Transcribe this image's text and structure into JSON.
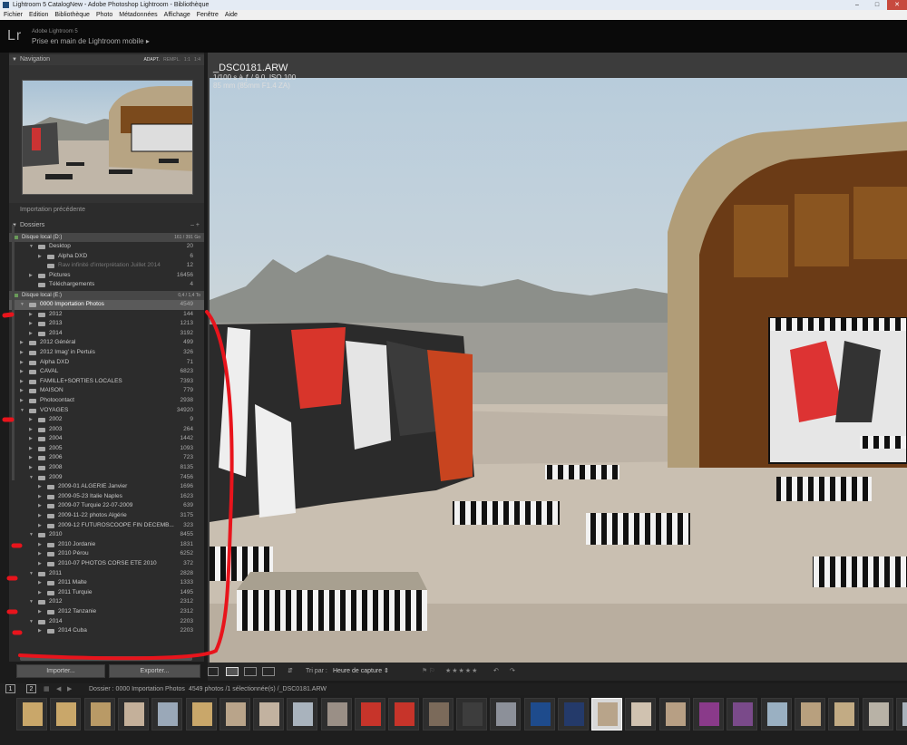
{
  "titlebar": {
    "text": "Lightroom 5 CatalogNew - Adobe Photoshop Lightroom - Bibliothèque"
  },
  "menu": [
    "Fichier",
    "Edition",
    "Bibliothèque",
    "Photo",
    "Métadonnées",
    "Affichage",
    "Fenêtre",
    "Aide"
  ],
  "identity": {
    "logo": "Lr",
    "brand": "Adobe Lightroom 5",
    "subtitle": "Prise en main de Lightroom mobile"
  },
  "navigator": {
    "title": "Navigation",
    "zoom": [
      "ADAPT.",
      "REMPL.",
      "1:1",
      "1:4"
    ]
  },
  "prev_import": "Importation précédente",
  "folders": {
    "title": "Dossiers",
    "volumes": [
      {
        "name": "Disque local (D:)",
        "capacity": "161 / 391 Go"
      },
      {
        "name": "Disque local (E:)",
        "capacity": "0,4 / 1,4 To"
      }
    ],
    "rows_d": [
      {
        "name": "Desktop",
        "count": "20",
        "level": 1,
        "tog": "▼"
      },
      {
        "name": "Alpha DXD",
        "count": "6",
        "level": 2,
        "tog": "▶"
      },
      {
        "name": "Raw infinité d'interprétation Juillet 2014",
        "count": "12",
        "level": 2,
        "tog": "",
        "dim": true
      },
      {
        "name": "Pictures",
        "count": "16456",
        "level": 1,
        "tog": "▶"
      },
      {
        "name": "Téléchargements",
        "count": "4",
        "level": 1,
        "tog": ""
      }
    ],
    "rows_e": [
      {
        "name": "0000 Importation Photos",
        "count": "4549",
        "level": 0,
        "tog": "▼",
        "sel": true
      },
      {
        "name": "2012",
        "count": "144",
        "level": 1,
        "tog": "▶"
      },
      {
        "name": "2013",
        "count": "1213",
        "level": 1,
        "tog": "▶"
      },
      {
        "name": "2014",
        "count": "3192",
        "level": 1,
        "tog": "▶"
      },
      {
        "name": "2012 Général",
        "count": "499",
        "level": 0,
        "tog": "▶"
      },
      {
        "name": "2012 Imag' in Pertuis",
        "count": "326",
        "level": 0,
        "tog": "▶"
      },
      {
        "name": "Alpha DXD",
        "count": "71",
        "level": 0,
        "tog": "▶"
      },
      {
        "name": "CAVAL",
        "count": "6823",
        "level": 0,
        "tog": "▶"
      },
      {
        "name": "FAMILLE+SORTIES LOCALES",
        "count": "7393",
        "level": 0,
        "tog": "▶"
      },
      {
        "name": "MAISON",
        "count": "779",
        "level": 0,
        "tog": "▶"
      },
      {
        "name": "Photocontact",
        "count": "2938",
        "level": 0,
        "tog": "▶"
      },
      {
        "name": "VOYAGES",
        "count": "34920",
        "level": 0,
        "tog": "▼"
      },
      {
        "name": "2002",
        "count": "9",
        "level": 1,
        "tog": "▶"
      },
      {
        "name": "2003",
        "count": "264",
        "level": 1,
        "tog": "▶"
      },
      {
        "name": "2004",
        "count": "1442",
        "level": 1,
        "tog": "▶"
      },
      {
        "name": "2005",
        "count": "1093",
        "level": 1,
        "tog": "▶"
      },
      {
        "name": "2006",
        "count": "723",
        "level": 1,
        "tog": "▶"
      },
      {
        "name": "2008",
        "count": "8135",
        "level": 1,
        "tog": "▶"
      },
      {
        "name": "2009",
        "count": "7456",
        "level": 1,
        "tog": "▼"
      },
      {
        "name": "2009-01 ALGERIE Janvier",
        "count": "1696",
        "level": 2,
        "tog": "▶"
      },
      {
        "name": "2009-05-23 Italie Naples",
        "count": "1623",
        "level": 2,
        "tog": "▶"
      },
      {
        "name": "2009-07 Turquie 22-07-2009",
        "count": "639",
        "level": 2,
        "tog": "▶"
      },
      {
        "name": "2009-11-22 photos Algérie",
        "count": "3175",
        "level": 2,
        "tog": "▶"
      },
      {
        "name": "2009-12 FUTUROSCOOPE FIN DECEMB...",
        "count": "323",
        "level": 2,
        "tog": "▶"
      },
      {
        "name": "2010",
        "count": "8455",
        "level": 1,
        "tog": "▼"
      },
      {
        "name": "2010 Jordanie",
        "count": "1831",
        "level": 2,
        "tog": "▶"
      },
      {
        "name": "2010 Pérou",
        "count": "6252",
        "level": 2,
        "tog": "▶"
      },
      {
        "name": "2010-07 PHOTOS CORSE ETE 2010",
        "count": "372",
        "level": 2,
        "tog": "▶"
      },
      {
        "name": "2011",
        "count": "2828",
        "level": 1,
        "tog": "▼"
      },
      {
        "name": "2011 Malte",
        "count": "1333",
        "level": 2,
        "tog": "▶"
      },
      {
        "name": "2011 Turquie",
        "count": "1495",
        "level": 2,
        "tog": "▶"
      },
      {
        "name": "2012",
        "count": "2312",
        "level": 1,
        "tog": "▼"
      },
      {
        "name": "2012 Tanzanie",
        "count": "2312",
        "level": 2,
        "tog": "▶"
      },
      {
        "name": "2014",
        "count": "2203",
        "level": 1,
        "tog": "▼"
      },
      {
        "name": "2014 Cuba",
        "count": "2203",
        "level": 2,
        "tog": "▶"
      }
    ]
  },
  "buttons": {
    "import": "Importer...",
    "export": "Exporter..."
  },
  "photo_info": {
    "filename": "_DSC0181.ARW",
    "exposure": "1/100 s à ƒ / 9,0, ISO 100",
    "lens": "85 mm (85mm F1.4 ZA)"
  },
  "toolbar": {
    "sort_label": "Tri par :",
    "sort_value": "Heure de capture"
  },
  "filmstrip": {
    "pages": [
      "1",
      "2"
    ],
    "source": "Dossier : 0000 Importation Photos",
    "count": "4549 photos /1 sélectionnée(s) /_DSC0181.ARW"
  },
  "colors": {
    "accent_annotation": "#e8141c",
    "selected_row": "#5a5a5a",
    "panel": "#2c2c2c"
  }
}
